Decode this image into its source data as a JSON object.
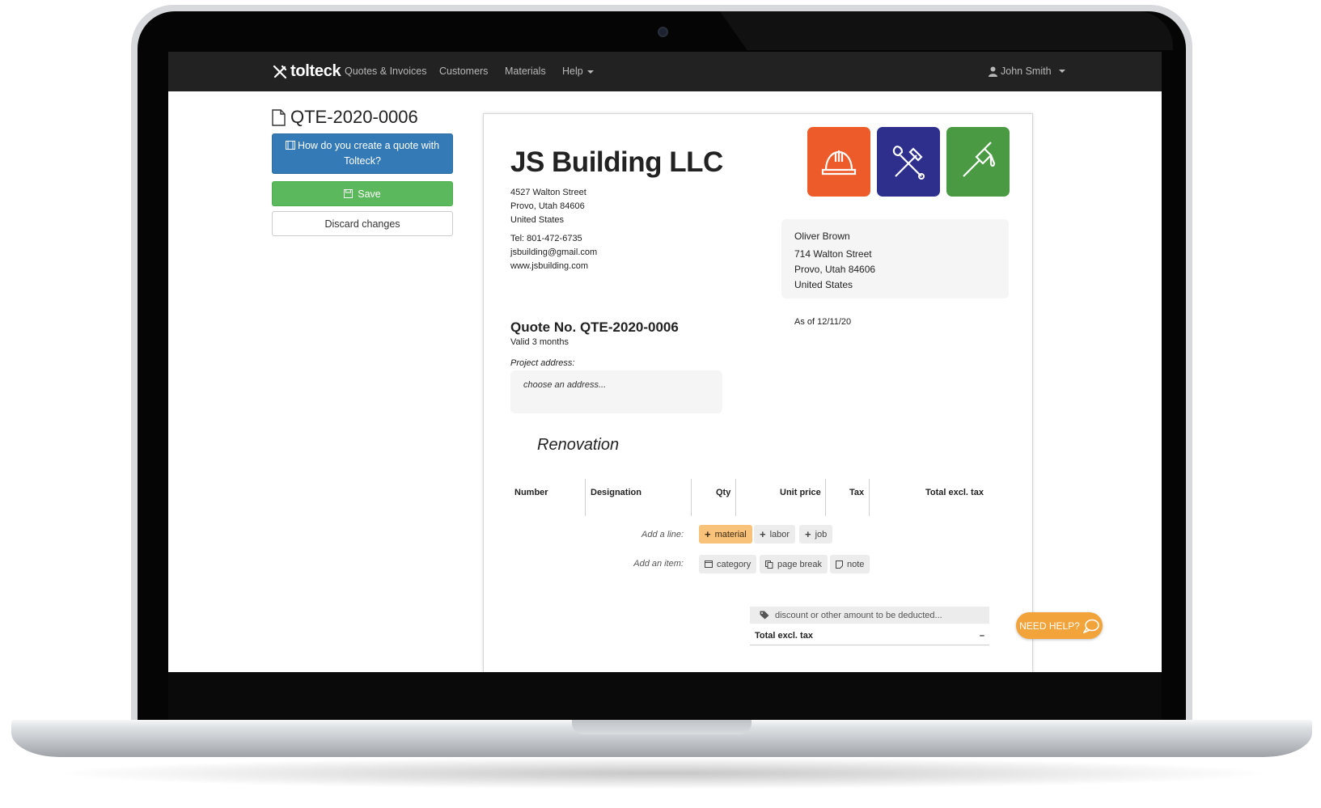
{
  "navbar": {
    "brand": "tolteck",
    "items": [
      "Quotes & Invoices",
      "Customers",
      "Materials",
      "Help"
    ],
    "user": "John Smith"
  },
  "sidebar": {
    "doc_title": "QTE-2020-0006",
    "help_button": "How do you create a quote with Tolteck?",
    "save_button": "Save",
    "discard_button": "Discard changes"
  },
  "quote": {
    "company": "JS Building LLC",
    "company_address": [
      "4527 Walton Street",
      "Provo, Utah 84606",
      "United States"
    ],
    "company_contact": [
      "Tel: 801-472-6735",
      "jsbuilding@gmail.com",
      "www.jsbuilding.com"
    ],
    "client": [
      "Oliver Brown",
      "714  Walton Street",
      "Provo, Utah 84606",
      "United States"
    ],
    "as_of": "As of 12/11/20",
    "quote_no": "Quote No. QTE-2020-0006",
    "valid": "Valid 3 months",
    "project_label": "Project address:",
    "project_placeholder": "choose an address...",
    "section": "Renovation",
    "columns": [
      "Number",
      "Designation",
      "Qty",
      "Unit price",
      "Tax",
      "Total excl. tax"
    ],
    "add_line_label": "Add a line:",
    "add_line_options": [
      "material",
      "labor",
      "job"
    ],
    "add_item_label": "Add an item:",
    "add_item_options": [
      "category",
      "page break",
      "note"
    ],
    "discount_placeholder": "discount or other amount to be deducted...",
    "total_label": "Total excl. tax",
    "total_value": "–"
  },
  "need_help": "NEED HELP?",
  "colors": {
    "navbar": "#222222",
    "primary": "#337ab7",
    "success": "#5cb85c",
    "accent_chip": "#f8c27a",
    "need_help": "#f2a33a",
    "logo_orange": "#ee5b2b",
    "logo_blue": "#2e2f8d",
    "logo_green": "#4a9a44"
  },
  "icons": {
    "brand": "tools-icon",
    "doc": "file-icon",
    "help": "film-icon",
    "save": "floppy-icon",
    "user": "user-icon",
    "discount": "tag-icon",
    "chat": "chat-bubble-icon"
  }
}
